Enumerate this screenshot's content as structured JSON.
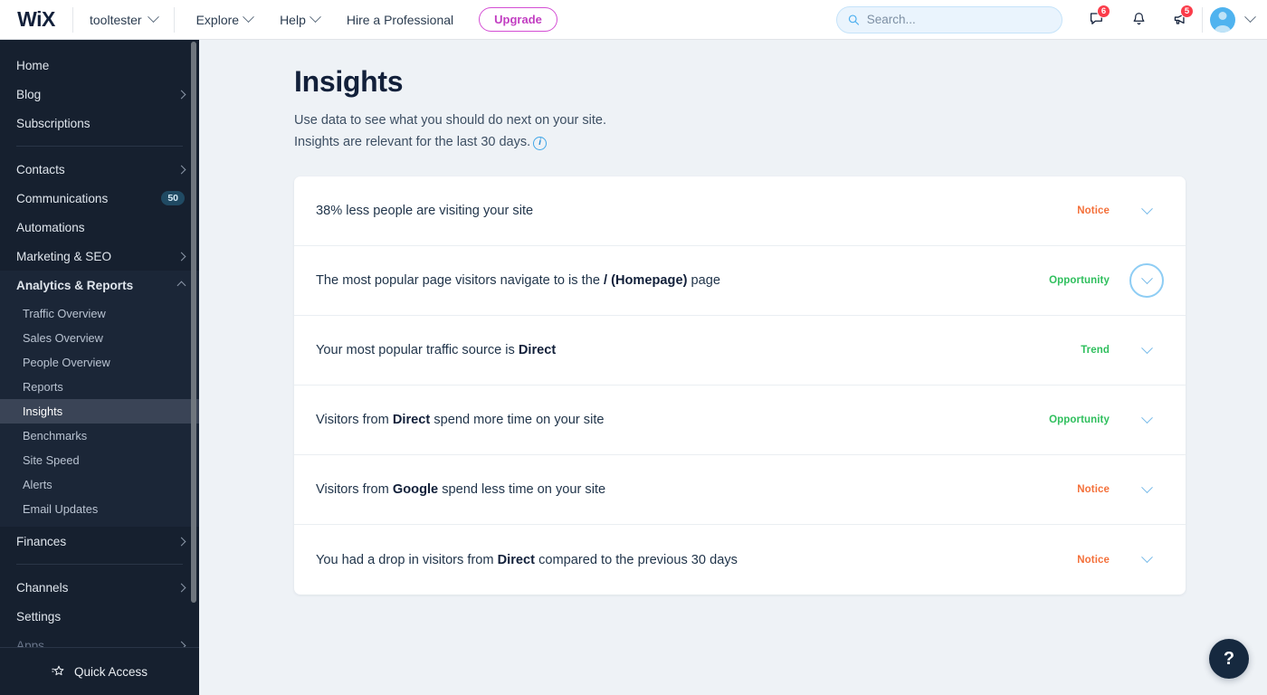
{
  "topbar": {
    "logo": "WiX",
    "site_name": "tooltester",
    "menu": [
      {
        "label": "Explore",
        "caret": true
      },
      {
        "label": "Help",
        "caret": true
      },
      {
        "label": "Hire a Professional",
        "caret": false
      }
    ],
    "upgrade_label": "Upgrade",
    "search_placeholder": "Search...",
    "search_value": "",
    "icons": [
      {
        "name": "chat-icon",
        "badge": "6"
      },
      {
        "name": "bell-icon",
        "badge": ""
      },
      {
        "name": "megaphone-icon",
        "badge": "5"
      }
    ]
  },
  "sidebar": {
    "top_items": [
      {
        "label": "Home",
        "arrow": false
      },
      {
        "label": "Blog",
        "arrow": true
      },
      {
        "label": "Subscriptions",
        "arrow": false
      }
    ],
    "mid_items": [
      {
        "label": "Contacts",
        "arrow": true,
        "badge": ""
      },
      {
        "label": "Communications",
        "arrow": false,
        "badge": "50"
      },
      {
        "label": "Automations",
        "arrow": false,
        "badge": ""
      },
      {
        "label": "Marketing & SEO",
        "arrow": true,
        "badge": ""
      }
    ],
    "analytics_label": "Analytics & Reports",
    "analytics_sub": [
      {
        "label": "Traffic Overview",
        "active": false
      },
      {
        "label": "Sales Overview",
        "active": false
      },
      {
        "label": "People Overview",
        "active": false
      },
      {
        "label": "Reports",
        "active": false
      },
      {
        "label": "Insights",
        "active": true
      },
      {
        "label": "Benchmarks",
        "active": false
      },
      {
        "label": "Site Speed",
        "active": false
      },
      {
        "label": "Alerts",
        "active": false
      },
      {
        "label": "Email Updates",
        "active": false
      }
    ],
    "finances": {
      "label": "Finances",
      "arrow": true
    },
    "bottom_items": [
      {
        "label": "Channels",
        "arrow": true,
        "muted": false
      },
      {
        "label": "Settings",
        "arrow": false,
        "muted": false
      },
      {
        "label": "Apps",
        "arrow": true,
        "muted": true
      }
    ],
    "quick_access": "Quick Access"
  },
  "main": {
    "title": "Insights",
    "subtitle_line1": "Use data to see what you should do next on your site.",
    "subtitle_line2": "Insights are relevant for the last 30 days.",
    "insights": [
      {
        "text_pre": "38% less people are visiting your site",
        "text_bold": "",
        "text_post": "",
        "tag": "Notice",
        "tag_type": "notice",
        "focused": false
      },
      {
        "text_pre": "The most popular page visitors navigate to is the ",
        "text_bold": "/ (Homepage)",
        "text_post": " page",
        "tag": "Opportunity",
        "tag_type": "green",
        "focused": true
      },
      {
        "text_pre": "Your most popular traffic source is ",
        "text_bold": "Direct",
        "text_post": "",
        "tag": "Trend",
        "tag_type": "green",
        "focused": false
      },
      {
        "text_pre": "Visitors from ",
        "text_bold": "Direct",
        "text_post": " spend more time on your site",
        "tag": "Opportunity",
        "tag_type": "green",
        "focused": false
      },
      {
        "text_pre": "Visitors from ",
        "text_bold": "Google",
        "text_post": " spend less time on your site",
        "tag": "Notice",
        "tag_type": "notice",
        "focused": false
      },
      {
        "text_pre": "You had a drop in visitors from ",
        "text_bold": "Direct",
        "text_post": " compared to the previous 30 days",
        "tag": "Notice",
        "tag_type": "notice",
        "focused": false
      }
    ],
    "help_label": "?"
  },
  "colors": {
    "notice": "#f4703a",
    "opportunity": "#2fbf5d",
    "upgrade": "#c23ec2",
    "badge_red": "#fb3c4a",
    "sidebar_bg": "#16202f"
  }
}
